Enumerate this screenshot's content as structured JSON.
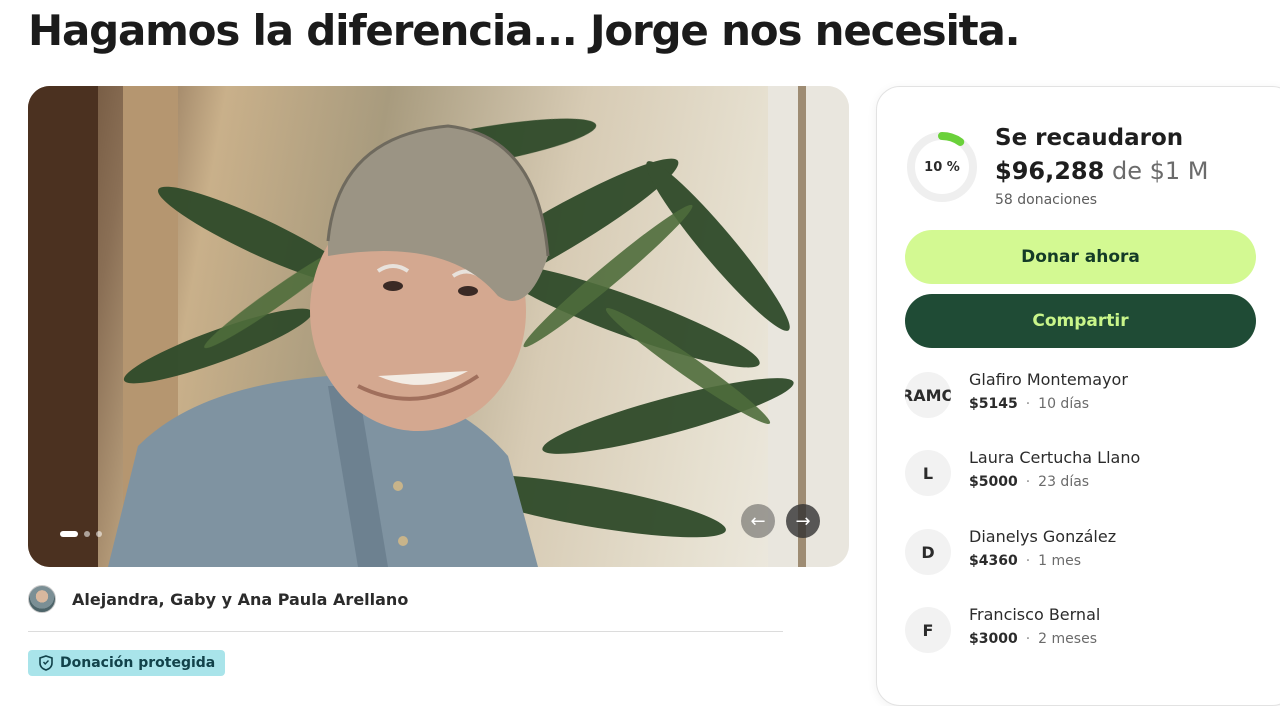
{
  "page": {
    "title": "Hagamos la diferencia... Jorge nos necesita."
  },
  "carousel": {
    "prev_icon": "←",
    "next_icon": "→"
  },
  "organizer": {
    "name": "Alejandra, Gaby y Ana Paula Arellano"
  },
  "badge": {
    "label": "Donación protegida"
  },
  "progress": {
    "percent_label": "10 %",
    "percent": 10,
    "heading": "Se recaudaron",
    "amount": "$96,288",
    "of": "de",
    "goal": "$1 M",
    "donations": "58 donaciones"
  },
  "buttons": {
    "donate": "Donar ahora",
    "share": "Compartir"
  },
  "donors": [
    {
      "initial": "RAMO",
      "name": "Glafiro Montemayor",
      "amount": "$5145",
      "time": "10 días"
    },
    {
      "initial": "L",
      "name": "Laura Certucha Llano",
      "amount": "$5000",
      "time": "23 días"
    },
    {
      "initial": "D",
      "name": "Dianelys González",
      "amount": "$4360",
      "time": "1 mes"
    },
    {
      "initial": "F",
      "name": "Francisco Bernal",
      "amount": "$3000",
      "time": "2 meses"
    }
  ],
  "colors": {
    "donate_bg": "#d3f992",
    "share_bg": "#1f4b35",
    "progress": "#6ad13a",
    "badge_bg": "#a9e4ea"
  }
}
